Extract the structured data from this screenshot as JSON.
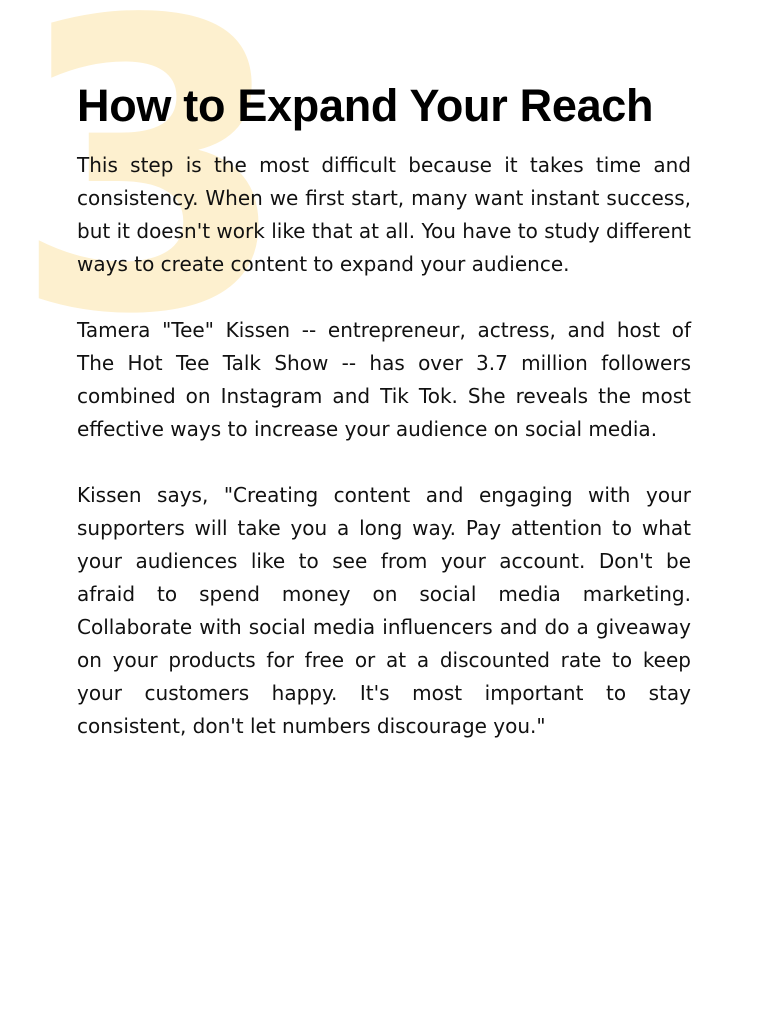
{
  "step": {
    "number": "3",
    "accent_color": "#fdf0cf"
  },
  "title": "How to Expand Your Reach",
  "paragraphs": [
    "This step is the most difficult because it takes time and consistency. When we first start, many want instant success, but it doesn't work like that at all. You have to study different ways to create content to expand your audience.",
    "Tamera \"Tee\" Kissen -- entrepreneur, actress, and host of The Hot Tee Talk Show -- has over 3.7 million followers combined on Instagram and Tik Tok. She reveals the most effective ways to increase your audience on social media.",
    "Kissen says, \"Creating content and engaging with your supporters will take you a long way. Pay attention to what your audiences like to see from your account. Don't be afraid to spend money on social media marketing. Collaborate with social media influencers and do a giveaway on your products for free or at a discounted rate to keep your customers happy. It's most important to stay consistent, don't let numbers discourage you.\""
  ]
}
